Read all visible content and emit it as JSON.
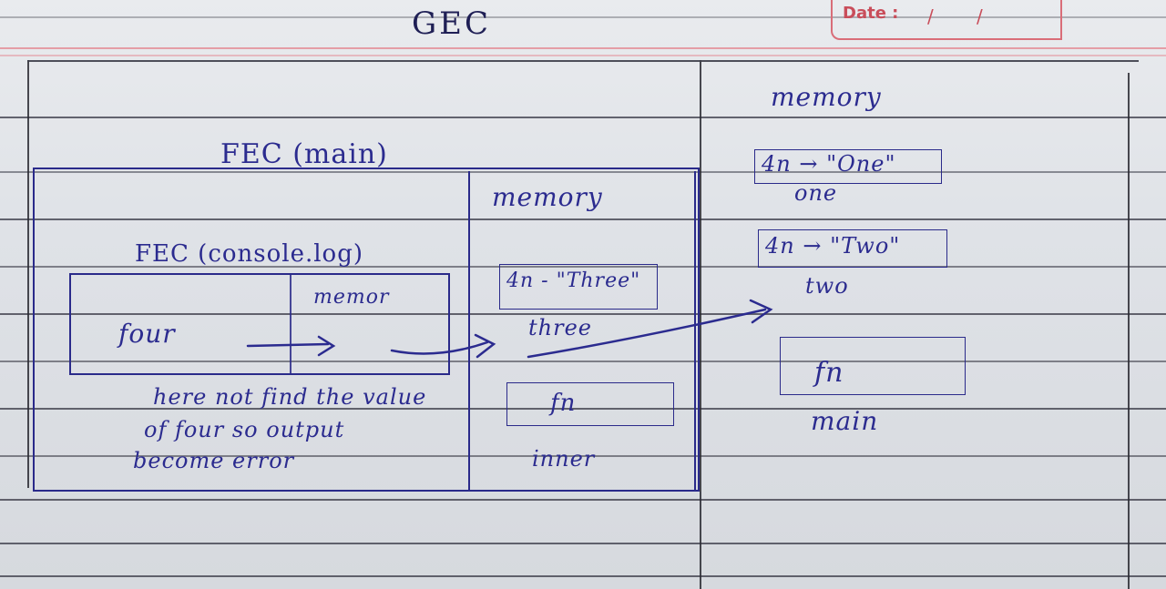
{
  "header": {
    "title": "GEC",
    "date_label": "Date :",
    "date_slash_1": "/",
    "date_slash_2": "/"
  },
  "global_memory": {
    "heading": "memory",
    "items": [
      {
        "box": "4n → \"One\"",
        "caption": "one"
      },
      {
        "box": "4n → \"Two\"",
        "caption": "two"
      },
      {
        "box": "fn",
        "caption": "main"
      }
    ]
  },
  "fec_main": {
    "heading": "FEC (main)",
    "memory_heading": "memory",
    "items": [
      {
        "box": "4n - \"Three\"",
        "caption": "three"
      },
      {
        "box": "fn",
        "caption": "inner"
      }
    ]
  },
  "fec_console": {
    "heading": "FEC (console.log)",
    "memory_label": "memor",
    "code_text": "four"
  },
  "note": {
    "lines": [
      "here not find the value",
      "of four so output",
      "become error"
    ]
  }
}
